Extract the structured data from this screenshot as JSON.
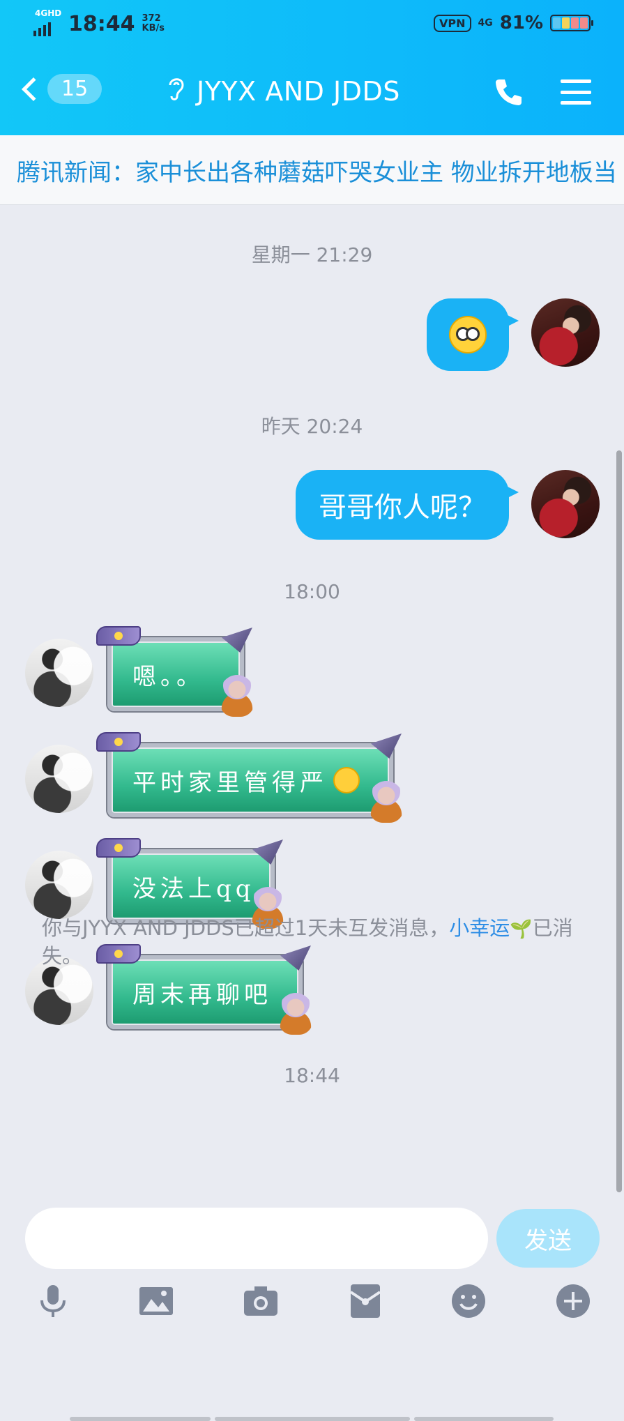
{
  "status_bar": {
    "network": "4GHD",
    "time": "18:44",
    "speed_value": "372",
    "speed_unit": "KB/s",
    "vpn": "VPN",
    "network_right": "4G",
    "battery": "81%"
  },
  "header": {
    "back_badge": "15",
    "title": "JYYX AND JDDS",
    "accent": "#0bb2fb"
  },
  "ticker": {
    "text": "腾讯新闻：家中长出各种蘑菇吓哭女业主  物业拆开地板当"
  },
  "messages": [
    {
      "type": "timestamp",
      "text": "星期一 21:29"
    },
    {
      "type": "outgoing",
      "content": "emoji",
      "emoji": "shocked-face"
    },
    {
      "type": "timestamp",
      "text": "昨天 20:24"
    },
    {
      "type": "outgoing",
      "text": "哥哥你人呢？"
    },
    {
      "type": "timestamp",
      "text": "18:00"
    },
    {
      "type": "incoming",
      "text": "嗯。。"
    },
    {
      "type": "incoming",
      "text": "平时家里管得严",
      "emoji": "sweat-face"
    },
    {
      "type": "incoming",
      "text": "没法上qq"
    },
    {
      "type": "incoming",
      "text": "周末再聊吧"
    },
    {
      "type": "timestamp",
      "text": "18:44"
    }
  ],
  "notice": {
    "prefix": "你与JYYX AND JDDS已超过1天未互发消息，",
    "link": "小幸运",
    "suffix": "已消失。"
  },
  "input": {
    "placeholder": "",
    "send_label": "发送"
  },
  "toolbar": {
    "items": [
      "microphone-icon",
      "image-icon",
      "camera-icon",
      "red-packet-icon",
      "emoji-icon",
      "plus-icon"
    ]
  }
}
